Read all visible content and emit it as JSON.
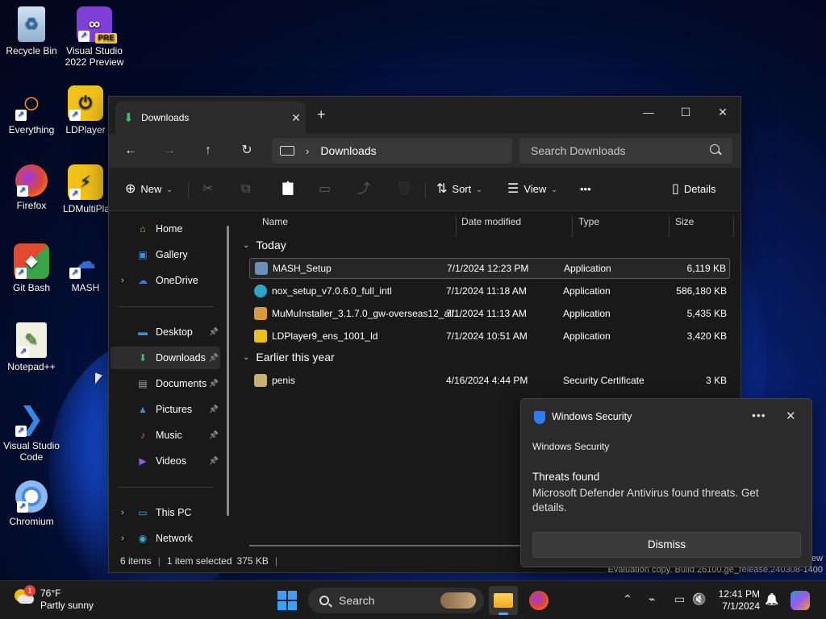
{
  "desktop": {
    "icons": [
      {
        "label": "Recycle Bin"
      },
      {
        "label": "Visual Studio 2022 Preview",
        "badge": "PRE"
      },
      {
        "label": "Everything"
      },
      {
        "label": "LDPlayer"
      },
      {
        "label": "Firefox"
      },
      {
        "label": "LDMultiPlayer"
      },
      {
        "label": "Git Bash"
      },
      {
        "label": "MASH"
      },
      {
        "label": "Notepad++"
      },
      {
        "label": "Visual Studio Code"
      },
      {
        "label": "Chromium"
      }
    ],
    "watermark_line1": "ew",
    "watermark_line2": "Evaluation copy. Build 26100.ge_release.240308-1400"
  },
  "explorer": {
    "tab_title": "Downloads",
    "tab_close": "✕",
    "new_tab": "+",
    "window_controls": {
      "minimize": "—",
      "maximize": "☐",
      "close": "✕"
    },
    "nav": {
      "back": "←",
      "forward": "→",
      "up": "↑",
      "refresh": "↻"
    },
    "breadcrumb": "Downloads",
    "breadcrumb_sep": "›",
    "search_placeholder": "Search Downloads",
    "commands": {
      "new": "New",
      "sort": "Sort",
      "view": "View",
      "more": "•••",
      "details": "Details",
      "new_icon": "⊕",
      "sort_icon": "⇅",
      "view_icon": "☰",
      "details_icon": "▯",
      "cut_icon": "✂",
      "copy_icon": "⧉",
      "paste_icon": "📋",
      "rename_icon": "▭",
      "share_icon": "⤴",
      "delete_icon": "🗑",
      "dropdown": "⌄"
    },
    "nav_pane": [
      {
        "label": "Home",
        "icon": "⌂",
        "color": "#f0a030"
      },
      {
        "label": "Gallery",
        "icon": "▣",
        "color": "#3a8ee6"
      },
      {
        "label": "OneDrive",
        "icon": "☁",
        "color": "#2f7cf2",
        "chevron": "›"
      },
      {
        "label": "Desktop",
        "icon": "▬",
        "color": "#3a8ee6",
        "pin": "📌"
      },
      {
        "label": "Downloads",
        "icon": "⬇",
        "color": "#3cc36b",
        "pin": "📌"
      },
      {
        "label": "Documents",
        "icon": "▤",
        "color": "#9aa4b0",
        "pin": "📌"
      },
      {
        "label": "Pictures",
        "icon": "▲",
        "color": "#3a8ee6",
        "pin": "📌"
      },
      {
        "label": "Music",
        "icon": "♪",
        "color": "#e0607a",
        "pin": "📌"
      },
      {
        "label": "Videos",
        "icon": "▶",
        "color": "#8a5ae6",
        "pin": "📌"
      },
      {
        "label": "This PC",
        "icon": "▭",
        "color": "#3ab0e6",
        "chevron": "›"
      },
      {
        "label": "Network",
        "icon": "◉",
        "color": "#3ab0e6",
        "chevron": "›"
      }
    ],
    "columns": {
      "name": "Name",
      "date": "Date modified",
      "type": "Type",
      "size": "Size"
    },
    "groups": [
      {
        "label": "Today",
        "chevron": "⌄"
      },
      {
        "label": "Earlier this year",
        "chevron": "⌄"
      }
    ],
    "files": [
      {
        "name": "MASH_Setup",
        "date": "7/1/2024 12:23 PM",
        "type": "Application",
        "size": "6,119 KB",
        "color": "#6a8fb8"
      },
      {
        "name": "nox_setup_v7.0.6.0_full_intl",
        "date": "7/1/2024 11:18 AM",
        "type": "Application",
        "size": "586,180 KB",
        "color": "#2aa4c8"
      },
      {
        "name": "MuMuInstaller_3.1.7.0_gw-overseas12_all...",
        "date": "7/1/2024 11:13 AM",
        "type": "Application",
        "size": "5,435 KB",
        "color": "#d89a3a"
      },
      {
        "name": "LDPlayer9_ens_1001_ld",
        "date": "7/1/2024 10:51 AM",
        "type": "Application",
        "size": "3,420 KB",
        "color": "#e8c020"
      },
      {
        "name": "penis",
        "date": "4/16/2024 4:44 PM",
        "type": "Security Certificate",
        "size": "3 KB",
        "color": "#c8b070"
      }
    ],
    "status": {
      "items": "6 items",
      "selected": "1 item selected",
      "size": "375 KB",
      "sep": "|"
    }
  },
  "toast": {
    "app": "Windows Security",
    "more": "•••",
    "close": "✕",
    "header": "Windows Security",
    "title": "Threats found",
    "body": "Microsoft Defender Antivirus found threats. Get details.",
    "button": "Dismiss"
  },
  "taskbar": {
    "temperature": "76°F",
    "condition": "Partly sunny",
    "weather_badge": "1",
    "search": "Search",
    "time": "12:41 PM",
    "date": "7/1/2024",
    "tray": {
      "chevron": "⌃",
      "network": "⌁",
      "display": "▭",
      "volume": "🔇",
      "bell": "🔔"
    }
  }
}
